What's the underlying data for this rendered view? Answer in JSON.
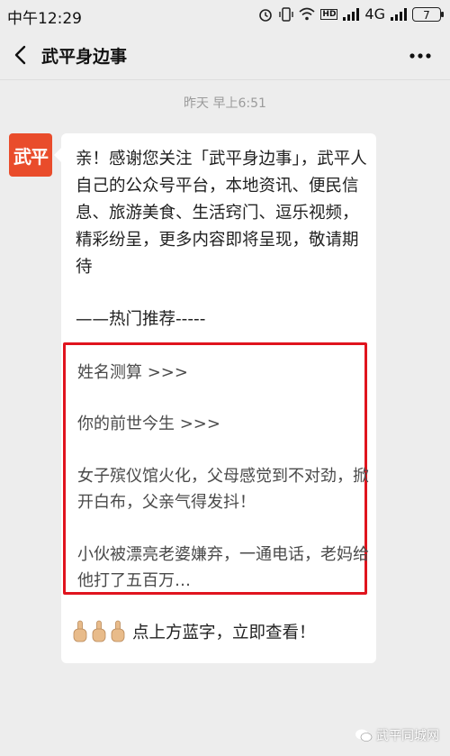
{
  "status_bar": {
    "time": "中午12:29",
    "network": "4G",
    "hd_label": "HD",
    "battery": "7"
  },
  "nav": {
    "title": "武平身边事"
  },
  "chat": {
    "timestamp": "昨天 早上6:51",
    "avatar_text": "武平",
    "intro": "亲！感谢您关注「武平身边事」，武平人自己的公众号平台，本地资讯、便民信息、旅游美食、生活窍门、逗乐视频，精彩纷呈，更多内容即将呈现，敬请期待",
    "section_title": "——热门推荐-----",
    "recommendations": [
      "姓名测算 >>>",
      "你的前世今生 >>>",
      "女子殡仪馆火化，父母感觉到不对劲，掀开白布，父亲气得发抖！",
      "小伙被漂亮老婆嫌弃，一通电话，老妈给他打了五百万…"
    ],
    "footer_text": "点上方蓝字，立即查看！"
  },
  "watermark": "武平同城网",
  "colors": {
    "avatar_bg": "#e94c2b",
    "highlight_border": "#e0141e",
    "background": "#ededed"
  }
}
